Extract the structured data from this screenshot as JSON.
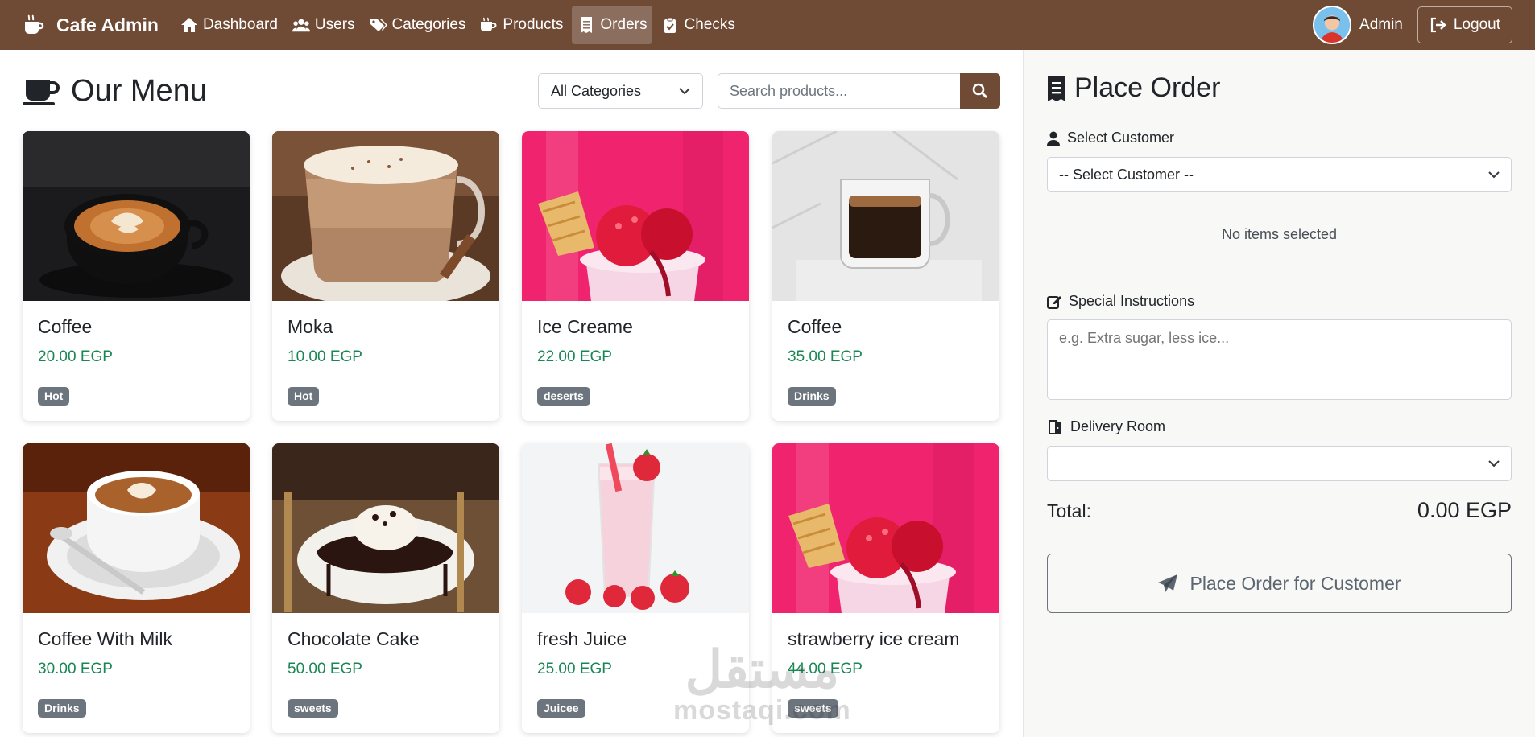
{
  "navbar": {
    "brand": "Cafe Admin",
    "items": [
      {
        "label": "Dashboard",
        "icon": "home-icon",
        "active": false
      },
      {
        "label": "Users",
        "icon": "users-icon",
        "active": false
      },
      {
        "label": "Categories",
        "icon": "tags-icon",
        "active": false
      },
      {
        "label": "Products",
        "icon": "mug-icon",
        "active": false
      },
      {
        "label": "Orders",
        "icon": "receipt-icon",
        "active": true
      },
      {
        "label": "Checks",
        "icon": "clipboard-check-icon",
        "active": false
      }
    ],
    "user_name": "Admin",
    "logout_label": "Logout"
  },
  "menu": {
    "title": "Our Menu",
    "category_filter": "All Categories",
    "search_placeholder": "Search products...",
    "products": [
      {
        "name": "Coffee",
        "price": "20.00 EGP",
        "category": "Hot",
        "image": "latte-art-black-cup"
      },
      {
        "name": "Moka",
        "price": "10.00 EGP",
        "category": "Hot",
        "image": "mocha-glass-mug"
      },
      {
        "name": "Ice Creame",
        "price": "22.00 EGP",
        "category": "deserts",
        "image": "strawberry-ice-cream-pink"
      },
      {
        "name": "Coffee",
        "price": "35.00 EGP",
        "category": "Drinks",
        "image": "espresso-glass-cup"
      },
      {
        "name": "Coffee With Milk",
        "price": "30.00 EGP",
        "category": "Drinks",
        "image": "latte-art-white-cup"
      },
      {
        "name": "Chocolate Cake",
        "price": "50.00 EGP",
        "category": "sweets",
        "image": "chocolate-cake-plate"
      },
      {
        "name": "fresh Juice",
        "price": "25.00 EGP",
        "category": "Juicee",
        "image": "strawberry-smoothie-glass"
      },
      {
        "name": "strawberry ice cream",
        "price": "44.00 EGP",
        "category": "sweets",
        "image": "strawberry-ice-cream-pink"
      }
    ]
  },
  "order": {
    "title": "Place Order",
    "customer_label": "Select Customer",
    "customer_value": "-- Select Customer --",
    "empty_text": "No items selected",
    "instructions_label": "Special Instructions",
    "instructions_placeholder": "e.g. Extra sugar, less ice...",
    "room_label": "Delivery Room",
    "room_value": "",
    "total_label": "Total:",
    "total_value": "0.00 EGP",
    "submit_label": "Place Order for Customer"
  },
  "watermark": {
    "arabic": "مستقل",
    "latin": "mostaqi.com"
  },
  "colors": {
    "navbar": "#6f4a35",
    "price": "#198754",
    "badge": "#6c757d"
  }
}
